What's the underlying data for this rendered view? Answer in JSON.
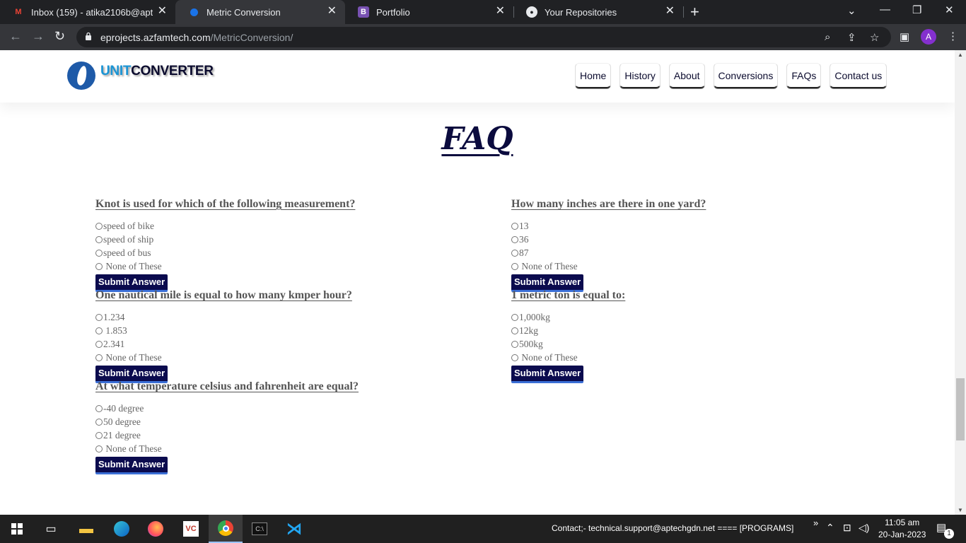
{
  "browser": {
    "tabs": [
      {
        "title": "Inbox (159) - atika2106b@aptech",
        "icon": "gmail-icon"
      },
      {
        "title": "Metric Conversion",
        "icon": "site-icon"
      },
      {
        "title": "Portfolio",
        "icon": "bootstrap-icon"
      },
      {
        "title": "Your Repositories",
        "icon": "github-icon"
      }
    ],
    "url_host": "eprojects.azfamtech.com",
    "url_path": "/MetricConversion/",
    "profile_initial": "A"
  },
  "site": {
    "logo_part1": "UNIT",
    "logo_part2": "CONVERTER",
    "nav": [
      "Home",
      "History",
      "About",
      "Conversions",
      "FAQs",
      "Contact us"
    ],
    "faq_title": "FAQ",
    "submit_label": "Submit Answer",
    "questions": [
      {
        "q": "Knot is used for which of the following measurement?",
        "options": [
          "speed of bike",
          "speed of ship",
          "speed of bus",
          " None of These"
        ]
      },
      {
        "q": "How many inches are there in one yard?",
        "options": [
          "13",
          "36",
          "87",
          " None of These"
        ]
      },
      {
        "q": "One nautical mile is equal to how many kmper hour?",
        "options": [
          "1.234",
          " 1.853",
          "2.341",
          " None of These"
        ]
      },
      {
        "q": "1 metric ton is equal to:",
        "options": [
          "1,000kg",
          "12kg",
          "500kg",
          " None of These"
        ]
      },
      {
        "q": "At what temperature celsius and fahrenheit are equal?",
        "options": [
          "-40 degree",
          "50 degree",
          "21 degree",
          " None of These"
        ]
      }
    ]
  },
  "taskbar": {
    "contact_text": "Contact;-   technical.support@aptechgdn.net   ====   [PROGRAMS]",
    "time": "11:05 am",
    "date": "20-Jan-2023",
    "notification_count": "1"
  }
}
